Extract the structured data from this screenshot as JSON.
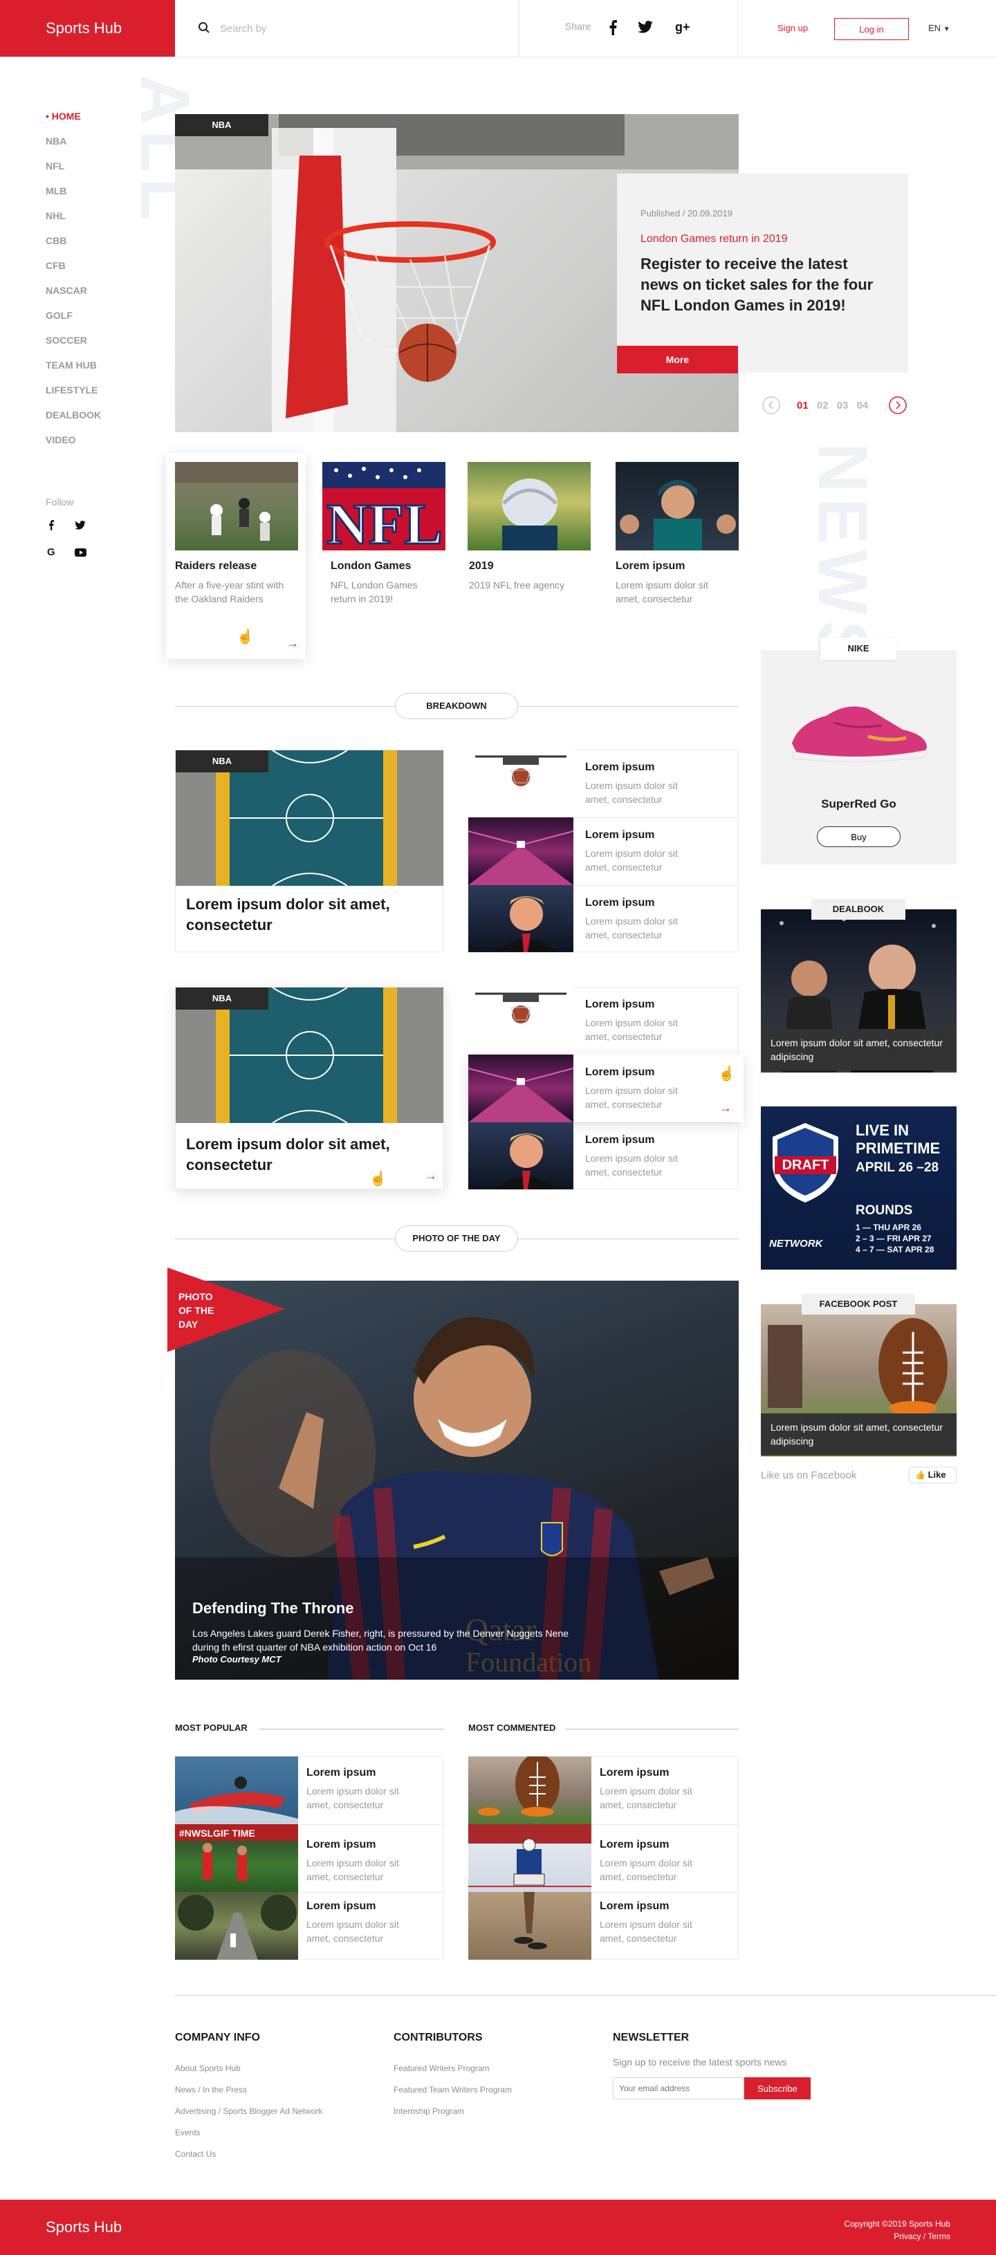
{
  "header": {
    "logo": "Sports Hub",
    "search_placeholder": "Search by",
    "share_label": "Share",
    "signup": "Sign up",
    "login": "Log in",
    "language": "EN"
  },
  "sidebar": {
    "items": [
      "• HOME",
      "NBA",
      "NFL",
      "MLB",
      "NHL",
      "CBB",
      "CFB",
      "NASCAR",
      "GOLF",
      "SOCCER",
      "TEAM HUB",
      "LIFESTYLE",
      "DEALBOOK",
      "VIDEO"
    ],
    "follow_label": "Follow",
    "watermark": "ALL"
  },
  "hero": {
    "tag": "NBA",
    "published": "Published / 20.09.2019",
    "kicker": "London Games return in 2019",
    "headline": "Register to receive the latest news on ticket sales for the four NFL London Games in 2019!",
    "more_button": "More",
    "pages": [
      "01",
      "02",
      "03",
      "04"
    ],
    "watermark": "NEWS"
  },
  "cards": [
    {
      "title": "Raiders release",
      "sub": "After a five-year stint with the Oakland Raiders"
    },
    {
      "title": "London Games",
      "sub": "NFL London Games return in 2019!"
    },
    {
      "title": "2019",
      "sub": "2019 NFL free agency"
    },
    {
      "title": "Lorem ipsum",
      "sub": "Lorem ipsum dolor sit amet, consectetur"
    }
  ],
  "breakdown": {
    "label": "BREAKDOWN",
    "blocks": [
      {
        "tag": "NBA",
        "title": "Lorem ipsum dolor sit amet, consectetur",
        "list": [
          {
            "title": "Lorem ipsum",
            "sub": "Lorem ipsum dolor sit amet, consectetur"
          },
          {
            "title": "Lorem ipsum",
            "sub": "Lorem ipsum dolor sit amet, consectetur"
          },
          {
            "title": "Lorem ipsum",
            "sub": "Lorem ipsum dolor sit amet, consectetur"
          }
        ]
      },
      {
        "tag": "NBA",
        "title": "Lorem ipsum dolor sit amet, consectetur",
        "list": [
          {
            "title": "Lorem ipsum",
            "sub": "Lorem ipsum dolor sit amet, consectetur"
          },
          {
            "title": "Lorem ipsum",
            "sub": "Lorem ipsum dolor sit amet, consectetur"
          },
          {
            "title": "Lorem ipsum",
            "sub": "Lorem ipsum dolor sit amet, consectetur"
          }
        ]
      }
    ]
  },
  "photo_of_day": {
    "label": "PHOTO OF THE DAY",
    "badge": "PHOTO OF THE DAY",
    "title": "Defending The Throne",
    "caption": "Los Angeles Lakes guard Derek Fisher, right, is pressured by the Denver Nuggets Nene during th efirst quarter of NBA exhibition action on Oct 16",
    "credit": "Photo Courtesy MCT"
  },
  "most_popular": {
    "label": "MOST POPULAR",
    "items": [
      {
        "title": "Lorem ipsum",
        "sub": "Lorem ipsum dolor sit amet, consectetur"
      },
      {
        "title": "Lorem ipsum",
        "sub": "Lorem ipsum dolor sit amet, consectetur"
      },
      {
        "title": "Lorem ipsum",
        "sub": "Lorem ipsum dolor sit amet, consectetur"
      }
    ]
  },
  "most_commented": {
    "label": "MOST COMMENTED",
    "items": [
      {
        "title": "Lorem ipsum",
        "sub": "Lorem ipsum dolor sit amet, consectetur"
      },
      {
        "title": "Lorem ipsum",
        "sub": "Lorem ipsum dolor sit amet, consectetur"
      },
      {
        "title": "Lorem ipsum",
        "sub": "Lorem ipsum dolor sit amet, consectetur"
      }
    ]
  },
  "rail": {
    "nike_tag": "NIKE",
    "nike_product": "SuperRed Go",
    "nike_buy": "Buy",
    "dealbook_tag": "DEALBOOK",
    "dealbook_caption": "Lorem ipsum dolor sit amet, consectetur adipiscing",
    "draft": {
      "logo": "DRAFT",
      "line1": "LIVE IN",
      "line2": "PRIMETIME",
      "dates": "APRIL 26 –28",
      "rounds": "ROUNDS",
      "r1": "1 — THU APR 26",
      "r2": "2 – 3 — FRI APR 27",
      "r3": "4 – 7 — SAT APR 28",
      "network": "NETWORK"
    },
    "facebook_tag": "FACEBOOK POST",
    "facebook_caption": "Lorem ipsum dolor sit amet, consectetur adipiscing",
    "like_us": "Like us on Facebook",
    "like_button": "Like"
  },
  "footer": {
    "company_head": "COMPANY INFO",
    "company_links": [
      "About Sports Hub",
      "News / In the Press",
      "Advertising / Sports Blogger Ad Network",
      "Events",
      "Contact Us"
    ],
    "contrib_head": "CONTRIBUTORS",
    "contrib_links": [
      "Featured Writers Program",
      "Featured Team Writers Program",
      "Internship Program"
    ],
    "newsletter_head": "NEWSLETTER",
    "newsletter_text": "Sign up to receive the latest sports news",
    "email_placeholder": "Your email address",
    "subscribe": "Subscribe",
    "bottom_logo": "Sports Hub",
    "copyright": "Copyright ©2019 Sports Hub",
    "legal": "Privacy / Terms"
  },
  "colors": {
    "accent": "#d91f2e",
    "dark": "#2a2a2a",
    "light_gray": "#f2f2f2"
  }
}
